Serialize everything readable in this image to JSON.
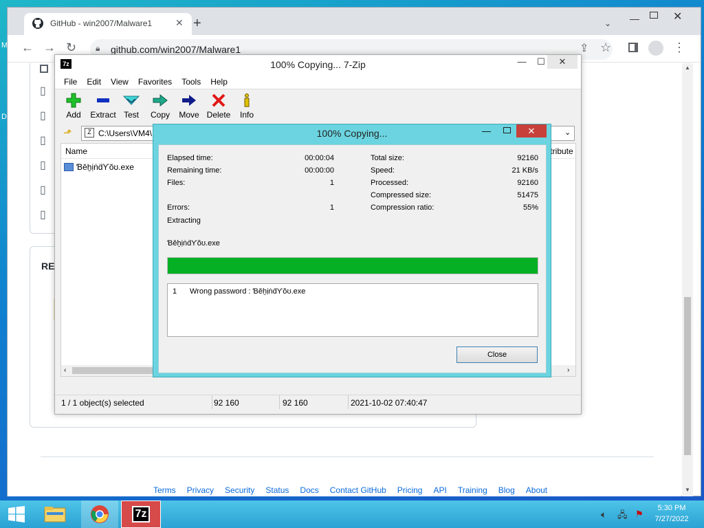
{
  "browser": {
    "tab_title": "GitHub - win2007/Malware1",
    "url": "github.com/win2007/Malware1",
    "footer_links": [
      "Terms",
      "Privacy",
      "Security",
      "Status",
      "Docs",
      "Contact GitHub",
      "Pricing",
      "API",
      "Training",
      "Blog",
      "About"
    ],
    "readme_partial": "REA"
  },
  "zip": {
    "title": "100% Copying... 7-Zip",
    "menu": [
      "File",
      "Edit",
      "View",
      "Favorites",
      "Tools",
      "Help"
    ],
    "toolbar": {
      "add": "Add",
      "extract": "Extract",
      "test": "Test",
      "copy": "Copy",
      "move": "Move",
      "delete": "Delete",
      "info": "Info"
    },
    "path": "C:\\Users\\VM4\\",
    "columns": {
      "name": "Name",
      "attributes": "ttribute"
    },
    "file_name": "ƁěẖịṅḋƳŏʊ.exe",
    "status": {
      "selected": "1 / 1 object(s) selected",
      "size": "92 160",
      "packed": "92 160",
      "modified": "2021-10-02 07:40:47"
    }
  },
  "dialog": {
    "title": "100% Copying...",
    "elapsed_label": "Elapsed time:",
    "elapsed_value": "00:00:04",
    "remaining_label": "Remaining time:",
    "remaining_value": "00:00:00",
    "files_label": "Files:",
    "files_value": "1",
    "errors_label": "Errors:",
    "errors_value": "1",
    "total_label": "Total size:",
    "total_value": "92160",
    "speed_label": "Speed:",
    "speed_value": "21 KB/s",
    "processed_label": "Processed:",
    "processed_value": "92160",
    "compressed_label": "Compressed size:",
    "compressed_value": "51475",
    "ratio_label": "Compression ratio:",
    "ratio_value": "55%",
    "operation": "Extracting",
    "current_file": "ƁěẖịṅḋƳŏʊ.exe",
    "progress": 1.0,
    "log_index": "1",
    "log_message": "Wrong password : ƁěẖịṅḋƳŏʊ.exe",
    "close_label": "Close"
  },
  "taskbar": {
    "time": "5:30 PM",
    "date": "7/27/2022"
  },
  "colors": {
    "progress": "#06b025",
    "accent": "#2aa2d4",
    "close": "#c7403a"
  }
}
